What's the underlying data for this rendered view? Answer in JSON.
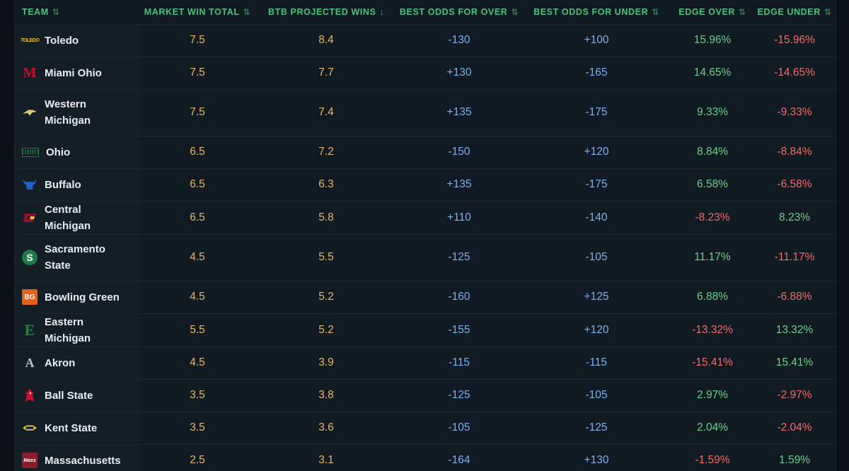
{
  "columns": {
    "team": "TEAM",
    "market": "MARKET WIN TOTAL",
    "projected": "BTB PROJECTED WINS",
    "over_odds": "BEST ODDS FOR OVER",
    "under_odds": "BEST ODDS FOR UNDER",
    "edge_over": "EDGE OVER",
    "edge_under": "EDGE UNDER"
  },
  "sort_icons": {
    "unsorted": "⇅",
    "descending": "↓"
  },
  "colors": {
    "header_green": "#4ec27a",
    "win_gold": "#e9b86a",
    "odds_blue": "#7fb2f0",
    "positive_green": "#6fd08f",
    "negative_red": "#ef6f6a"
  },
  "rows": [
    {
      "team": "Toledo",
      "logo_icon": "toledo-logo-icon",
      "logo_text": "TOLEDO",
      "market": "7.5",
      "projected": "8.4",
      "over_odds": "-130",
      "under_odds": "+100",
      "edge_over": "15.96%",
      "edge_under": "-15.96%"
    },
    {
      "team": "Miami Ohio",
      "logo_icon": "miami-ohio-logo-icon",
      "logo_text": "M",
      "market": "7.5",
      "projected": "7.7",
      "over_odds": "+130",
      "under_odds": "-165",
      "edge_over": "14.65%",
      "edge_under": "-14.65%"
    },
    {
      "team": "Western Michigan",
      "logo_icon": "western-michigan-logo-icon",
      "logo_text": "",
      "market": "7.5",
      "projected": "7.4",
      "over_odds": "+135",
      "under_odds": "-175",
      "edge_over": "9.33%",
      "edge_under": "-9.33%"
    },
    {
      "team": "Ohio",
      "logo_icon": "ohio-logo-icon",
      "logo_text": "OHIO",
      "market": "6.5",
      "projected": "7.2",
      "over_odds": "-150",
      "under_odds": "+120",
      "edge_over": "8.84%",
      "edge_under": "-8.84%"
    },
    {
      "team": "Buffalo",
      "logo_icon": "buffalo-logo-icon",
      "logo_text": "",
      "market": "6.5",
      "projected": "6.3",
      "over_odds": "+135",
      "under_odds": "-175",
      "edge_over": "6.58%",
      "edge_under": "-6.58%"
    },
    {
      "team": "Central Michigan",
      "logo_icon": "central-michigan-logo-icon",
      "logo_text": "",
      "market": "6.5",
      "projected": "5.8",
      "over_odds": "+110",
      "under_odds": "-140",
      "edge_over": "-8.23%",
      "edge_under": "8.23%"
    },
    {
      "team": "Sacramento State",
      "logo_icon": "sacramento-state-logo-icon",
      "logo_text": "S",
      "market": "4.5",
      "projected": "5.5",
      "over_odds": "-125",
      "under_odds": "-105",
      "edge_over": "11.17%",
      "edge_under": "-11.17%"
    },
    {
      "team": "Bowling Green",
      "logo_icon": "bowling-green-logo-icon",
      "logo_text": "BG",
      "market": "4.5",
      "projected": "5.2",
      "over_odds": "-160",
      "under_odds": "+125",
      "edge_over": "6.88%",
      "edge_under": "-6.88%"
    },
    {
      "team": "Eastern Michigan",
      "logo_icon": "eastern-michigan-logo-icon",
      "logo_text": "E",
      "market": "5.5",
      "projected": "5.2",
      "over_odds": "-155",
      "under_odds": "+120",
      "edge_over": "-13.32%",
      "edge_under": "13.32%"
    },
    {
      "team": "Akron",
      "logo_icon": "akron-logo-icon",
      "logo_text": "A",
      "market": "4.5",
      "projected": "3.9",
      "over_odds": "-115",
      "under_odds": "-115",
      "edge_over": "-15.41%",
      "edge_under": "15.41%"
    },
    {
      "team": "Ball State",
      "logo_icon": "ball-state-logo-icon",
      "logo_text": "",
      "market": "3.5",
      "projected": "3.8",
      "over_odds": "-125",
      "under_odds": "-105",
      "edge_over": "2.97%",
      "edge_under": "-2.97%"
    },
    {
      "team": "Kent State",
      "logo_icon": "kent-state-logo-icon",
      "logo_text": "",
      "market": "3.5",
      "projected": "3.6",
      "over_odds": "-105",
      "under_odds": "-125",
      "edge_over": "2.04%",
      "edge_under": "-2.04%"
    },
    {
      "team": "Massachusetts",
      "logo_icon": "massachusetts-logo-icon",
      "logo_text": "Mass",
      "market": "2.5",
      "projected": "3.1",
      "over_odds": "-164",
      "under_odds": "+130",
      "edge_over": "-1.59%",
      "edge_under": "1.59%"
    }
  ]
}
